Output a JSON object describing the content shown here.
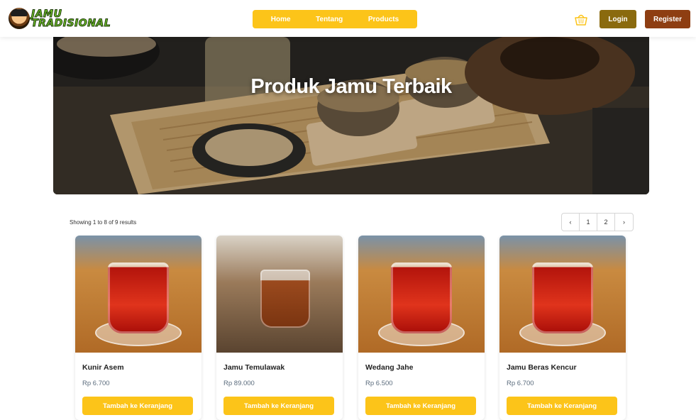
{
  "header": {
    "logo": {
      "word1": "JAMU",
      "word2": "TRADISIONAL"
    },
    "nav": [
      {
        "label": "Home"
      },
      {
        "label": "Tentang"
      },
      {
        "label": "Products"
      }
    ],
    "login_label": "Login",
    "register_label": "Register",
    "cart_icon": "basket-icon"
  },
  "hero": {
    "title": "Produk Jamu Terbaik"
  },
  "results": {
    "text": "Showing 1 to 8 of 9 results",
    "pagination": {
      "prev": "‹",
      "pages": [
        "1",
        "2"
      ],
      "next": "›"
    }
  },
  "products": [
    {
      "name": "Kunir Asem",
      "price": "Rp 6.700",
      "button": "Tambah ke Keranjang"
    },
    {
      "name": "Jamu Temulawak",
      "price": "Rp 89.000",
      "button": "Tambah ke Keranjang"
    },
    {
      "name": "Wedang Jahe",
      "price": "Rp 6.500",
      "button": "Tambah ke Keranjang"
    },
    {
      "name": "Jamu Beras Kencur",
      "price": "Rp 6.700",
      "button": "Tambah ke Keranjang"
    }
  ],
  "colors": {
    "accent": "#fcc419",
    "login": "#8a6a0e",
    "register": "#8e3e12"
  }
}
